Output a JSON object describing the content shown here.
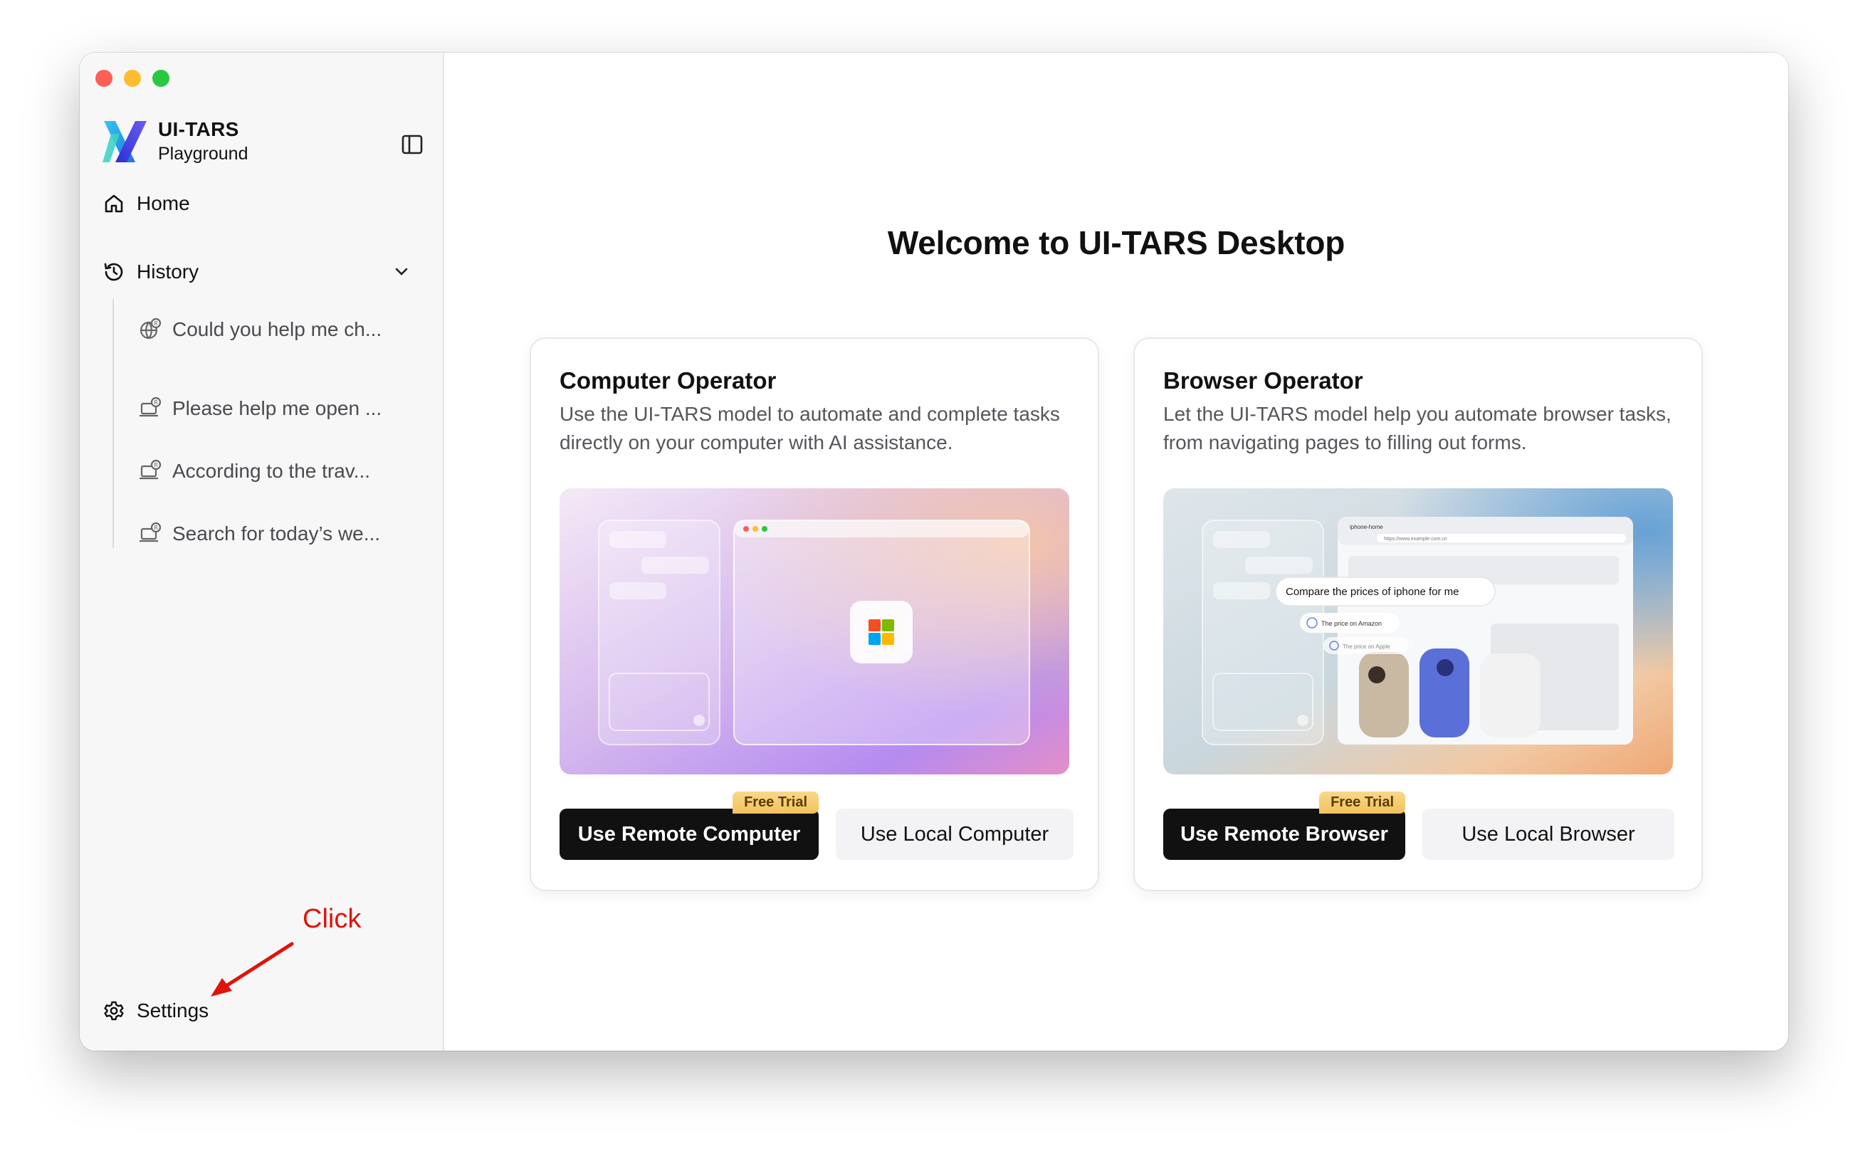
{
  "app": {
    "title": "UI-TARS",
    "subtitle": "Playground"
  },
  "sidebar": {
    "home_label": "Home",
    "history_label": "History",
    "history_items": [
      {
        "label": "Could you help me ch...",
        "icon": "browser-task-icon"
      },
      {
        "label": "Please help me open ...",
        "icon": "computer-task-icon"
      },
      {
        "label": "According to the trav...",
        "icon": "computer-task-icon"
      },
      {
        "label": "Search for today’s we...",
        "icon": "computer-task-icon"
      }
    ],
    "settings_label": "Settings"
  },
  "annotation": {
    "text": "Click",
    "color": "#e0130a"
  },
  "main": {
    "welcome": "Welcome to UI-TARS Desktop",
    "cards": [
      {
        "title": "Computer Operator",
        "description": "Use the UI-TARS model to automate and complete tasks directly on your computer with AI assistance.",
        "primary_button": "Use Remote Computer",
        "badge": "Free Trial",
        "secondary_button": "Use Local Computer"
      },
      {
        "title": "Browser Operator",
        "description": "Let the UI-TARS model help you automate browser tasks, from navigating pages to filling out forms.",
        "primary_button": "Use Remote Browser",
        "badge": "Free Trial",
        "secondary_button": "Use Local Browser",
        "illustration": {
          "tab_title": "iphone-home",
          "url": "https://www.example.com.cn",
          "prompt_bubble": "Compare the prices of iphone for me",
          "step_1": "The price on Amazon",
          "step_2": "The price on Apple"
        }
      }
    ]
  },
  "colors": {
    "accent_dark": "#111111",
    "badge": "#f2c35c",
    "traffic_red": "#fe5f57",
    "traffic_yellow": "#febc2e",
    "traffic_green": "#28c840"
  }
}
